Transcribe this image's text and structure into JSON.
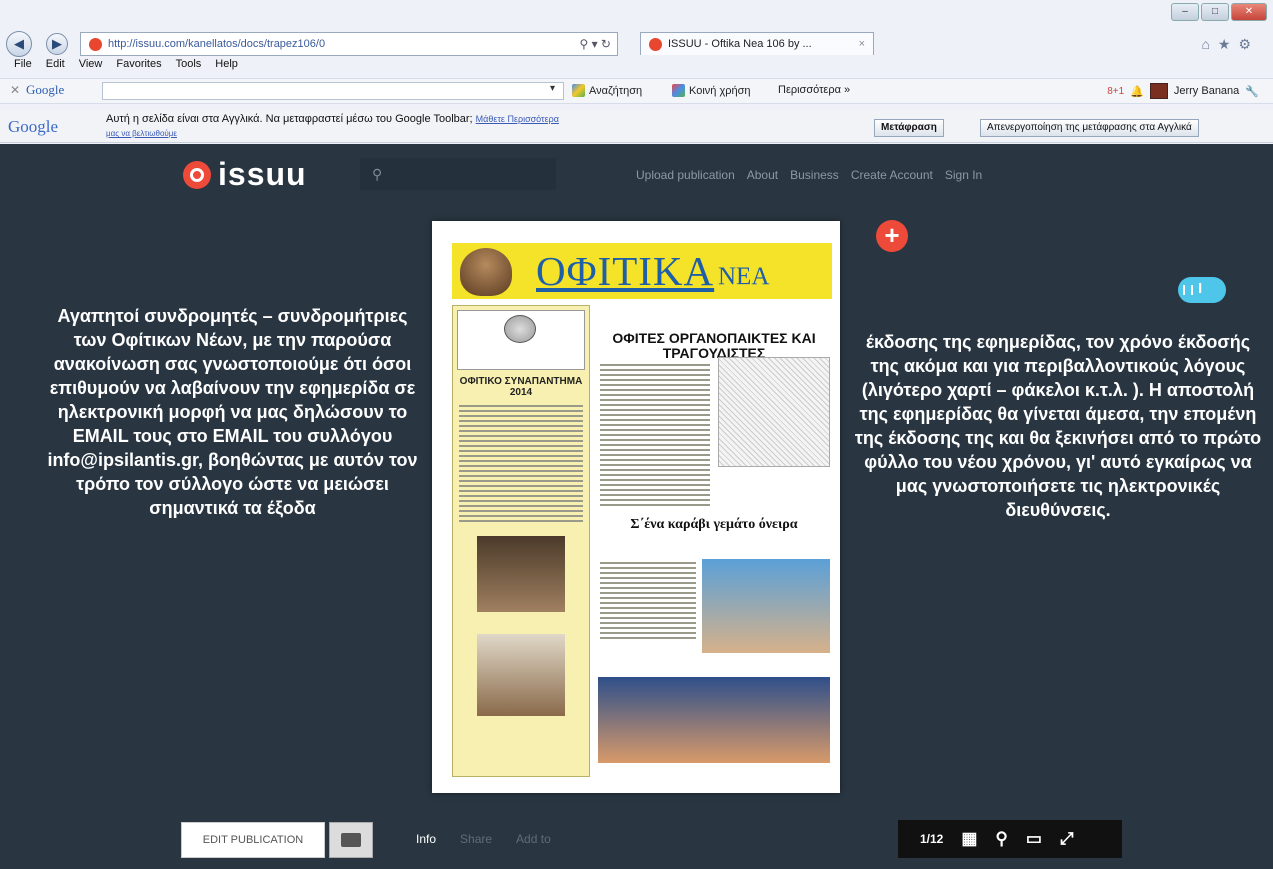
{
  "browser": {
    "url": "http://issuu.com/kanellatos/docs/trapez106/0",
    "tab_title": "ISSUU - Oftika Nea 106 by ...",
    "tab_close": "×",
    "menu": [
      "File",
      "Edit",
      "View",
      "Favorites",
      "Tools",
      "Help"
    ]
  },
  "google_toolbar": {
    "logo": "Google",
    "search_btn": "Αναζήτηση",
    "share_btn": "Κοινή χρήση",
    "more_btn": "Περισσότερα »",
    "user": "Jerry Banana",
    "translate_text": "Αυτή η σελίδα είναι στα Αγγλικά. Να μεταφραστεί μέσω του Google Toolbar;",
    "translate_link": "Μάθετε Περισσότερα",
    "translate_sub": "μας να βελτιωθούμε",
    "translate_btn": "Μετάφραση",
    "disable_btn": "Απενεργοποίηση της μετάφρασης στα Αγγλικά"
  },
  "issuu": {
    "logo_text": "issuu",
    "search_icon": "search-icon",
    "nav": [
      "Upload publication",
      "About",
      "Business",
      "Create Account",
      "Sign In"
    ]
  },
  "left_text": "Αγαπητοί συνδρομητές – συνδρομήτριες των Οφίτικων Νέων, με την παρούσα ανακοίνωση σας γνωστοποιούμε ότι όσοι επιθυμούν να λαβαίνουν την εφημερίδα σε ηλεκτρονική μορφή να μας δηλώσουν το EMAIL τους στο EMAIL του συλλόγου info@ipsilantis.gr, βοηθώντας με αυτόν τον τρόπο τον σύλλογο ώστε να μειώσει σημαντικά τα έξοδα",
  "right_text": "έκδοσης της εφημερίδας, τον χρόνο έκδοσής της ακόμα και για περιβαλλοντικούς λόγους (λιγότερο χαρτί – φάκελοι κ.τ.λ. ). Η αποστολή της εφημερίδας θα γίνεται άμεσα, την επομένη της έκδοσης της και θα ξεκινήσει από το πρώτο φύλλο του νέου χρόνου, γι' αυτό εγκαίρως να μας γνωστοποιήσετε τις ηλεκτρονικές διευθύνσεις.",
  "document": {
    "masthead_title": "ΟΦΙΤΙΚΑ",
    "masthead_sub": "ΝΕΑ",
    "headline": "ΟΦΙΤΕΣ ΟΡΓΑΝΟΠΑΙΚΤΕΣ ΚΑΙ ΤΡΑΓΟΥΔΙΣΤΕΣ",
    "side_title": "ΟΦΙΤΙΚΟ ΣΥΝΑΠΑΝΤΗΜΑ 2014",
    "sub_headline": "Σ΄ένα καράβι γεμάτο όνειρα"
  },
  "bottom": {
    "edit_btn": "EDIT PUBLICATION",
    "info": "Info",
    "share": "Share",
    "add_to": "Add to",
    "page_counter": "1/12"
  },
  "colors": {
    "issuu_bg": "#293642",
    "issuu_red": "#ee4a3a",
    "masthead_yellow": "#f4e328",
    "info_badge": "#4ec6ea"
  }
}
